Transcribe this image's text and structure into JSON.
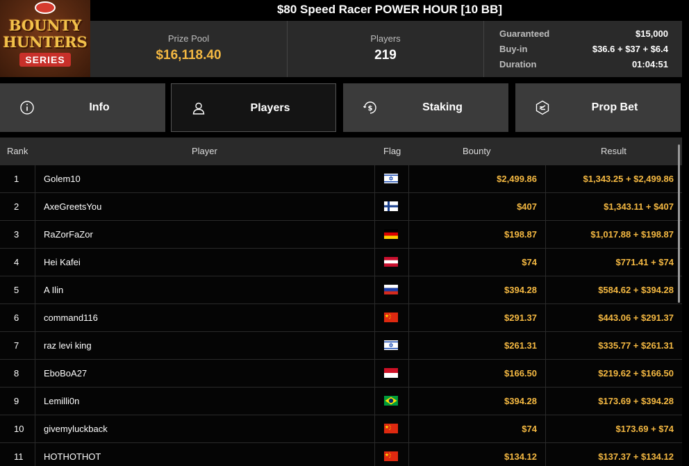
{
  "header": {
    "title": "$80 Speed Racer POWER HOUR [10 BB]",
    "logo": {
      "line1": "BOUNTY",
      "line2": "HUNTERS",
      "line3": "SERIES"
    }
  },
  "stats": {
    "prize_pool_label": "Prize Pool",
    "prize_pool_value": "$16,118.40",
    "players_label": "Players",
    "players_value": "219",
    "guaranteed_label": "Guaranteed",
    "guaranteed_value": "$15,000",
    "buyin_label": "Buy-in",
    "buyin_value": "$36.6 + $37 + $6.4",
    "duration_label": "Duration",
    "duration_value": "01:04:51"
  },
  "tabs": [
    {
      "label": "Info",
      "icon": "info-icon"
    },
    {
      "label": "Players",
      "icon": "user-icon"
    },
    {
      "label": "Staking",
      "icon": "dollar-coin-icon"
    },
    {
      "label": "Prop Bet",
      "icon": "prop-bet-icon"
    }
  ],
  "colors": {
    "accent": "#f5b942",
    "tab_bg": "#3b3b3b",
    "header_bg": "#2a2a2a"
  },
  "table": {
    "headers": {
      "rank": "Rank",
      "player": "Player",
      "flag": "Flag",
      "bounty": "Bounty",
      "result": "Result"
    },
    "rows": [
      {
        "rank": "1",
        "player": "Golem10",
        "flag": "israel",
        "bounty": "$2,499.86",
        "result": "$1,343.25 + $2,499.86"
      },
      {
        "rank": "2",
        "player": "AxeGreetsYou",
        "flag": "finland",
        "bounty": "$407",
        "result": "$1,343.11 + $407"
      },
      {
        "rank": "3",
        "player": "RaZorFaZor",
        "flag": "germany",
        "bounty": "$198.87",
        "result": "$1,017.88 + $198.87"
      },
      {
        "rank": "4",
        "player": "Hei Kafei",
        "flag": "austria",
        "bounty": "$74",
        "result": "$771.41 + $74"
      },
      {
        "rank": "5",
        "player": "A Ilin",
        "flag": "russia",
        "bounty": "$394.28",
        "result": "$584.62 + $394.28"
      },
      {
        "rank": "6",
        "player": "command116",
        "flag": "china",
        "bounty": "$291.37",
        "result": "$443.06 + $291.37"
      },
      {
        "rank": "7",
        "player": "raz levi king",
        "flag": "israel",
        "bounty": "$261.31",
        "result": "$335.77 + $261.31"
      },
      {
        "rank": "8",
        "player": "EboBoA27",
        "flag": "indonesia",
        "bounty": "$166.50",
        "result": "$219.62 + $166.50"
      },
      {
        "rank": "9",
        "player": "Lemilli0n",
        "flag": "brazil",
        "bounty": "$394.28",
        "result": "$173.69 + $394.28"
      },
      {
        "rank": "10",
        "player": "givemyluckback",
        "flag": "china",
        "bounty": "$74",
        "result": "$173.69 + $74"
      },
      {
        "rank": "11",
        "player": "HOTHOTHOT",
        "flag": "china",
        "bounty": "$134.12",
        "result": "$137.37 + $134.12"
      }
    ]
  }
}
